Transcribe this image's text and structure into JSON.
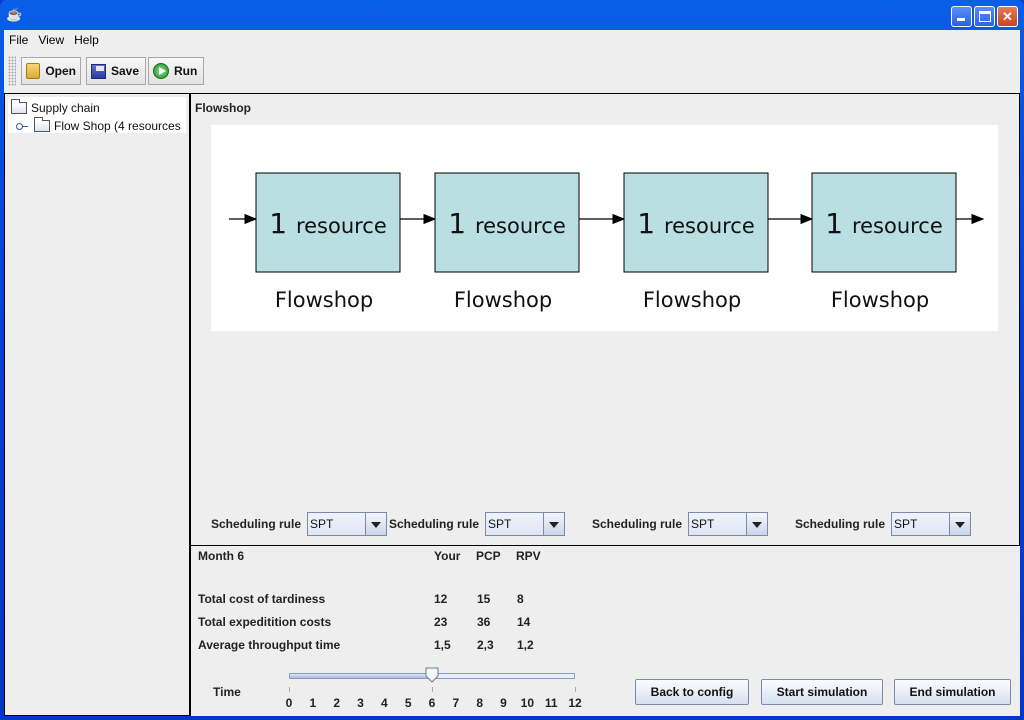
{
  "window": {
    "title": "",
    "controls": {
      "minimize": "minimize",
      "maximize": "maximize",
      "close": "✕"
    }
  },
  "menu": [
    "File",
    "View",
    "Help"
  ],
  "toolbar": {
    "open_label": "Open",
    "save_label": "Save",
    "run_label": "Run"
  },
  "tree": {
    "root": "Supply chain",
    "child": "Flow Shop (4 resources"
  },
  "main": {
    "title": "Flowshop",
    "diagram": {
      "stages": [
        {
          "box_label": "1 resource",
          "caption": "Flowshop"
        },
        {
          "box_label": "1 resource",
          "caption": "Flowshop"
        },
        {
          "box_label": "1 resource",
          "caption": "Flowshop"
        },
        {
          "box_label": "1 resource",
          "caption": "Flowshop"
        }
      ],
      "box_color": "#b9dfe2"
    },
    "scheduling": [
      {
        "label": "Scheduling rule",
        "value": "SPT"
      },
      {
        "label": "Scheduling rule",
        "value": "SPT"
      },
      {
        "label": "Scheduling rule",
        "value": "SPT"
      },
      {
        "label": "Scheduling rule",
        "value": "SPT"
      }
    ]
  },
  "results": {
    "period": "Month 6",
    "columns": [
      "Your",
      "PCP",
      "RPV"
    ],
    "rows": [
      {
        "label": "Total cost of tardiness",
        "values": [
          "12",
          "15",
          "8"
        ]
      },
      {
        "label": "Total expeditition costs",
        "values": [
          "23",
          "36",
          "14"
        ]
      },
      {
        "label": "Average throughput time",
        "values": [
          "1,5",
          "2,3",
          "1,2"
        ]
      }
    ]
  },
  "time_slider": {
    "label": "Time",
    "min": 0,
    "max": 12,
    "value": 6,
    "ticks": [
      "0",
      "1",
      "2",
      "3",
      "4",
      "5",
      "6",
      "7",
      "8",
      "9",
      "10",
      "11",
      "12"
    ]
  },
  "buttons": {
    "back": "Back to config",
    "start": "Start simulation",
    "end": "End simulation"
  }
}
